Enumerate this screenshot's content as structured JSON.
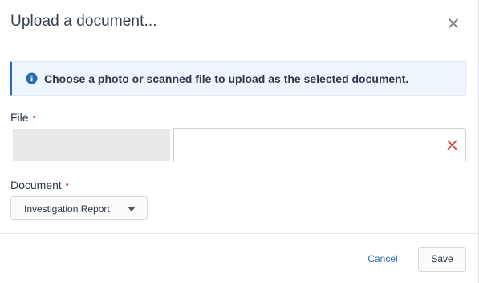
{
  "dialog": {
    "title": "Upload a document...",
    "close_icon": "close-icon"
  },
  "banner": {
    "icon": "info-icon",
    "text": "Choose a photo or scanned file to upload as the selected document."
  },
  "file_field": {
    "label": "File",
    "required_marker": "•",
    "clear_icon": "clear-icon",
    "value": ""
  },
  "document_field": {
    "label": "Document",
    "required_marker": "•",
    "selected": "Investigation Report",
    "caret_icon": "caret-down-icon"
  },
  "footer": {
    "cancel_label": "Cancel",
    "save_label": "Save"
  },
  "colors": {
    "accent": "#2b6cb0",
    "required": "#e53e3e",
    "banner_bg": "#eef5fc"
  }
}
